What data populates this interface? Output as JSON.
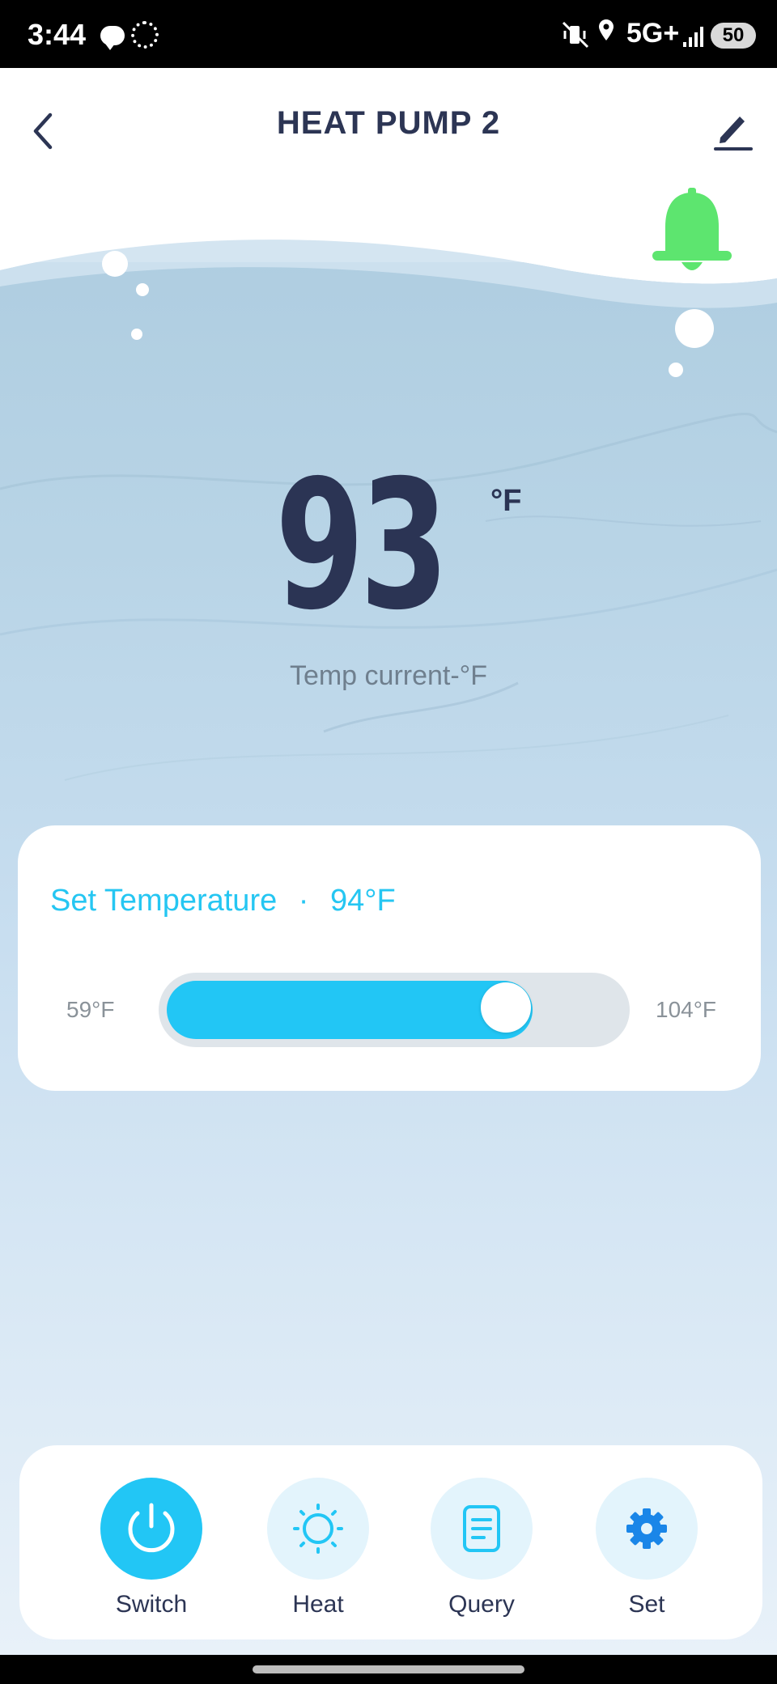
{
  "status_bar": {
    "time": "3:44",
    "network": "5G+",
    "battery": "50"
  },
  "header": {
    "title": "HEAT PUMP 2"
  },
  "current": {
    "value": "93",
    "unit": "°F",
    "label": "Temp current-°F"
  },
  "set_temperature": {
    "label": "Set Temperature",
    "separator": "·",
    "value": "94°F",
    "min_label": "59°F",
    "max_label": "104°F",
    "slider_fraction": 0.78
  },
  "bottom_bar": {
    "items": [
      {
        "label": "Switch",
        "icon": "power-icon",
        "active": true
      },
      {
        "label": "Heat",
        "icon": "sun-icon",
        "active": false
      },
      {
        "label": "Query",
        "icon": "document-icon",
        "active": false
      },
      {
        "label": "Set",
        "icon": "gear-icon",
        "active": false
      }
    ]
  },
  "colors": {
    "accent": "#22c6f5",
    "title": "#2c3554",
    "bell": "#5de56f"
  }
}
